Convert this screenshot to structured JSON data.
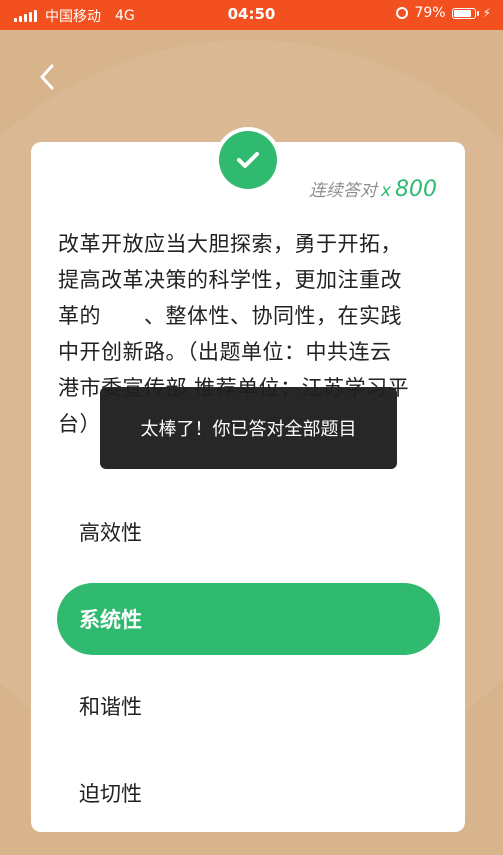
{
  "status_bar": {
    "carrier": "中国移动",
    "network": "4G",
    "time": "04:50",
    "battery": "79%",
    "battery_level": 0.79
  },
  "quiz": {
    "streak_label": "连续答对",
    "streak_multiplier": "x",
    "streak_count": "800",
    "question_lines": [
      "改革开放应当大胆探索，勇于开拓，",
      "提高改革决策的科学性，更加注重改",
      "革的　　、整体性、协同性，在实践",
      "中开创新路。（出题单位：中共连云",
      "港市委宣传部 推荐单位：江苏学习平",
      "台）"
    ],
    "options": [
      {
        "label": "高效性",
        "selected": false
      },
      {
        "label": "系统性",
        "selected": true
      },
      {
        "label": "和谐性",
        "selected": false
      },
      {
        "label": "迫切性",
        "selected": false
      }
    ]
  },
  "toast": {
    "message": "太棒了！你已答对全部题目"
  },
  "colors": {
    "status_bar": "#f2501f",
    "background": "#d8b48d",
    "accent": "#2fba70",
    "toast_bg": "#1e1e1e"
  },
  "icons": {
    "back": "chevron-left-icon",
    "check": "check-icon",
    "signal": "signal-icon",
    "alarm": "alarm-icon",
    "battery": "battery-icon"
  }
}
